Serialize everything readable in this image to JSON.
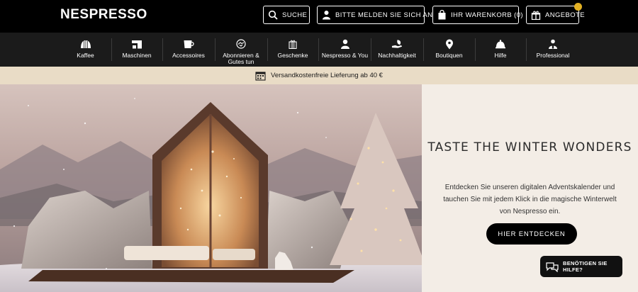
{
  "brand": {
    "logo_text": "NESPRESSO"
  },
  "topbar": {
    "search_label": "SUCHE",
    "login_label": "BITTE MELDEN SIE SICH AN",
    "cart_label": "IHR WARENKORB (0)",
    "offers_label": "ANGEBOTE"
  },
  "nav": {
    "items": [
      {
        "label": "Kaffee",
        "icon": "coffee-capsule-icon"
      },
      {
        "label": "Maschinen",
        "icon": "coffee-machine-icon"
      },
      {
        "label": "Accessoires",
        "icon": "cup-icon"
      },
      {
        "label": "Abonnieren & Gutes tun",
        "icon": "handshake-icon"
      },
      {
        "label": "Geschenke",
        "icon": "gift-icon"
      },
      {
        "label": "Nespresso & You",
        "icon": "person-icon"
      },
      {
        "label": "Nachhaltigkeit",
        "icon": "leaf-hand-icon"
      },
      {
        "label": "Boutiquen",
        "icon": "map-pin-icon"
      },
      {
        "label": "Hilfe",
        "icon": "bell-icon"
      },
      {
        "label": "Professional",
        "icon": "professional-icon"
      }
    ]
  },
  "banner": {
    "text": "Versandkostenfreie Lieferung ab 40 €",
    "icon": "delivery-calendar-icon"
  },
  "hero": {
    "title": "TASTE THE WINTER WONDERS",
    "description": "Entdecken Sie unseren digitalen Adventskalender und tauchen Sie mit jedem Klick in die magische Winterwelt von Nespresso ein.",
    "cta_label": "HIER ENTDECKEN"
  },
  "help": {
    "label": "BENÖTIGEN SIE HILFE?"
  },
  "colors": {
    "accent_dot": "#e2b023",
    "banner_bg": "#e9dcc6",
    "panel_bg": "#f3ede6",
    "nav_bg": "#1b1b1b"
  }
}
